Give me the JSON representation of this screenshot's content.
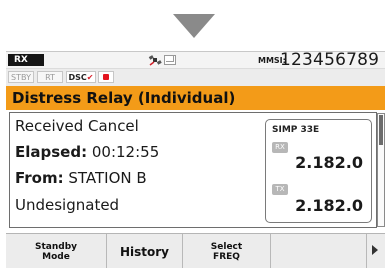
{
  "status_bar": {
    "rx_badge": "RX",
    "mmsi_label": "MMSI:",
    "mmsi_value": "123456789",
    "chips": {
      "stby": "STBY",
      "rt": "RT",
      "dsc": "DSC"
    }
  },
  "title": "Distress Relay (Individual)",
  "details": {
    "line1": "Received Cancel",
    "elapsed_label": "Elapsed:",
    "elapsed_value": "00:12:55",
    "from_label": "From:",
    "from_value": "STATION B",
    "line4": "Undesignated"
  },
  "channel_box": {
    "channel": "SIMP 33E",
    "rx_label": "RX",
    "rx_freq": "2.182.0",
    "tx_label": "TX",
    "tx_freq": "2.182.0"
  },
  "softkeys": {
    "standby_mode_line1": "Standby",
    "standby_mode_line2": "Mode",
    "history": "History",
    "select_freq_line1": "Select",
    "select_freq_line2": "FREQ"
  },
  "colors": {
    "title_bar": "#f39b18",
    "rec_indicator": "#e3141e",
    "dsc_check": "#d8202c"
  },
  "icons": [
    "down-arrow-icon",
    "satellite-icon",
    "message-icon",
    "record-icon",
    "more-arrow-icon"
  ]
}
